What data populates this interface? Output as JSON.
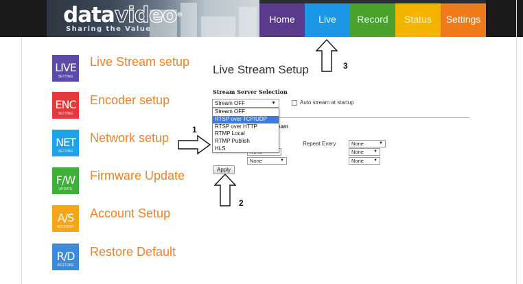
{
  "brand": {
    "logo_solid": "data",
    "logo_outline": "video",
    "logo_mark": "®",
    "tagline": "Sharing the Value"
  },
  "nav": {
    "home": "Home",
    "live": "Live",
    "record": "Record",
    "status": "Status",
    "settings": "Settings",
    "colors": {
      "home": "#5a3a8c",
      "live": "#1c97e6",
      "record": "#4aa22d",
      "status": "#f4b400",
      "settings": "#ef7a1a"
    }
  },
  "sidebar": {
    "items": [
      {
        "icon_big": "LIVE",
        "icon_small": "SETTING",
        "label": "Live Stream setup",
        "color": "#5b4aa6"
      },
      {
        "icon_big": "ENC",
        "icon_small": "SETTING",
        "label": "Encoder setup",
        "color": "#e23a3a"
      },
      {
        "icon_big": "NET",
        "icon_small": "SETTING",
        "label": "Network setup",
        "color": "#1fa3e8"
      },
      {
        "icon_big": "F/W",
        "icon_small": "UPDATE",
        "label": "Firmware Update",
        "color": "#3fae3a"
      },
      {
        "icon_big": "A/S",
        "icon_small": "ACCOUNT",
        "label": "Account Setup",
        "color": "#f4a51a"
      },
      {
        "icon_big": "R/D",
        "icon_small": "RESTORE",
        "label": "Restore Default",
        "color": "#3c8ad8"
      }
    ]
  },
  "main": {
    "title": "Live Stream Setup",
    "server_selection_label": "Stream Server Selection",
    "stream_select_value": "Stream OFF",
    "auto_stream_label": "Auto stream at startup",
    "auto_stream_checked": false,
    "partially_hidden_text": "eam",
    "repeat_every_label": "Repeat Every",
    "selects": {
      "a": "None",
      "b": "None",
      "c": "None",
      "d": "None",
      "e": "None"
    },
    "dropdown_options": [
      "Stream OFF",
      "RTSP over TCP/UDP",
      "RTSP over HTTP",
      "RTMP Local",
      "RTMP Publish",
      "HLS"
    ],
    "dropdown_highlighted": "RTSP over TCP/UDP",
    "apply_label": "Apply"
  },
  "annotations": {
    "one": "1",
    "two": "2",
    "three": "3"
  }
}
